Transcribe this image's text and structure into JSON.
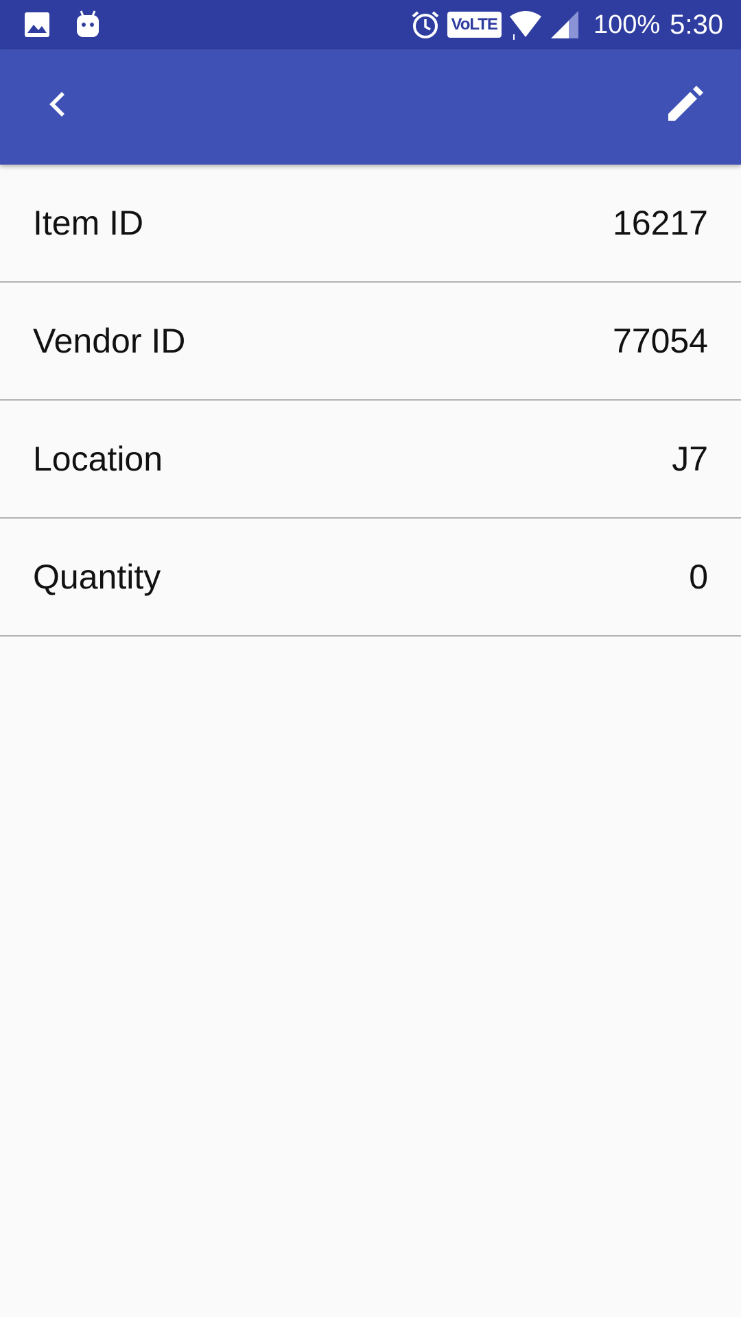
{
  "status_bar": {
    "icons_left": [
      "image-icon",
      "android-icon"
    ],
    "icons_right": [
      "alarm-icon",
      "volte-badge",
      "wifi-icon",
      "signal-icon"
    ],
    "volte_label": "VoLTE",
    "battery": "100%",
    "time": "5:30"
  },
  "app_bar": {
    "back_icon": "chevron-left-icon",
    "edit_icon": "pencil-icon",
    "color": "#3f51b5"
  },
  "details": [
    {
      "label": "Item ID",
      "value": "16217"
    },
    {
      "label": "Vendor ID",
      "value": "77054"
    },
    {
      "label": "Location",
      "value": "J7"
    },
    {
      "label": "Quantity",
      "value": "0"
    }
  ]
}
